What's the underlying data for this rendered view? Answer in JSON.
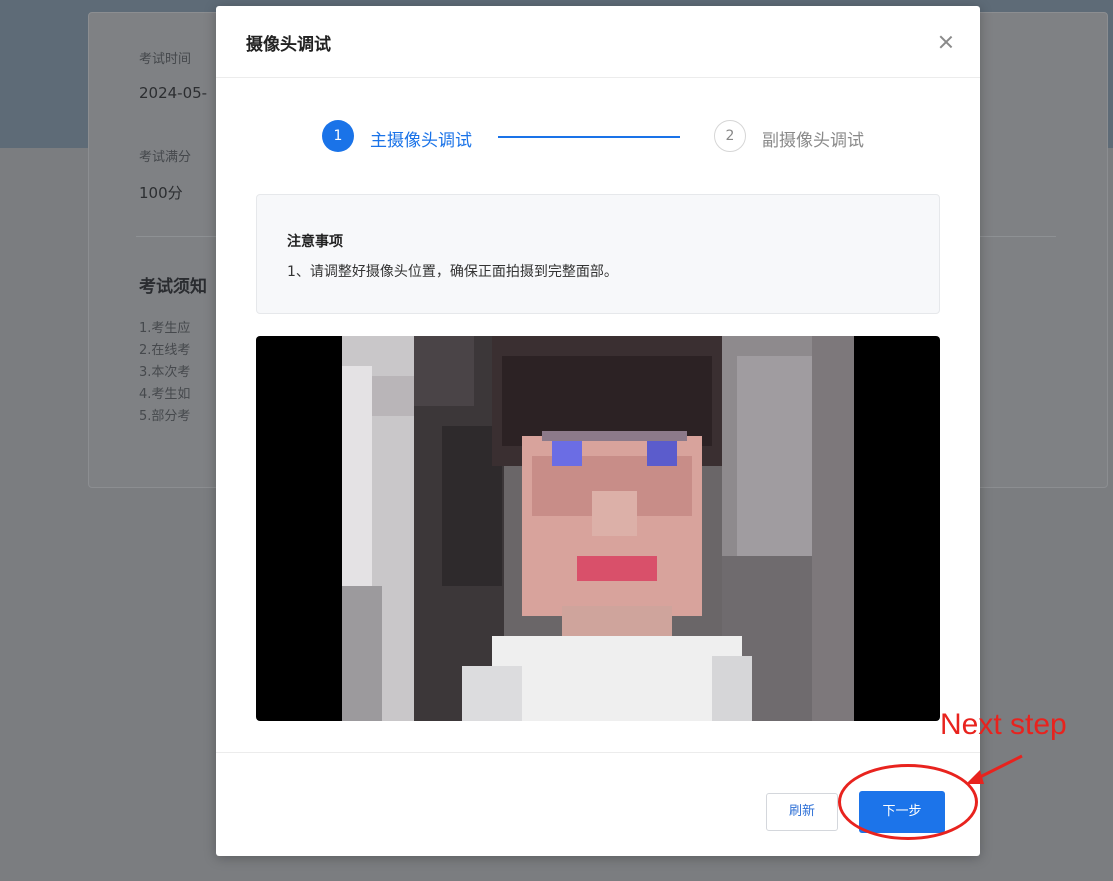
{
  "background_page": {
    "labels": [
      "考试时间",
      "考试满分"
    ],
    "values": [
      "2024-05-",
      "100分"
    ],
    "section_heading": "考试须知",
    "rules": [
      "1.考生应",
      "2.在线考",
      "3.本次考",
      "4.考生如",
      "5.部分考"
    ]
  },
  "modal": {
    "title": "摄像头调试",
    "close_icon": "close-icon",
    "steps": [
      {
        "number": "1",
        "label": "主摄像头调试",
        "state": "active"
      },
      {
        "number": "2",
        "label": "副摄像头调试",
        "state": "pending"
      }
    ],
    "notice": {
      "title": "注意事项",
      "items": [
        "1、请调整好摄像头位置，确保正面拍摄到完整面部。"
      ]
    },
    "camera_preview": "pixelated-face",
    "buttons": {
      "refresh": "刷新",
      "next": "下一步"
    }
  },
  "annotation": {
    "text": "Next step",
    "color": "#e8231e"
  },
  "colors": {
    "accent": "#1a73e8",
    "overlay": "#7b7d80"
  }
}
